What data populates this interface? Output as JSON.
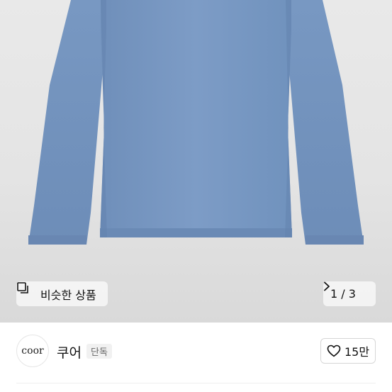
{
  "gallery": {
    "image_alt": "blue knit sweater product photo",
    "similar_label": "비슷한 상품",
    "similar_icon": "similar-products-icon",
    "counter": "1 / 3",
    "next_icon": "chevron-right-icon",
    "garment_color": "#7b9ac3"
  },
  "brand": {
    "logo_text": "coor",
    "name": "쿠어",
    "tag": "단독"
  },
  "like": {
    "icon": "heart-outline-icon",
    "count": "15만"
  }
}
